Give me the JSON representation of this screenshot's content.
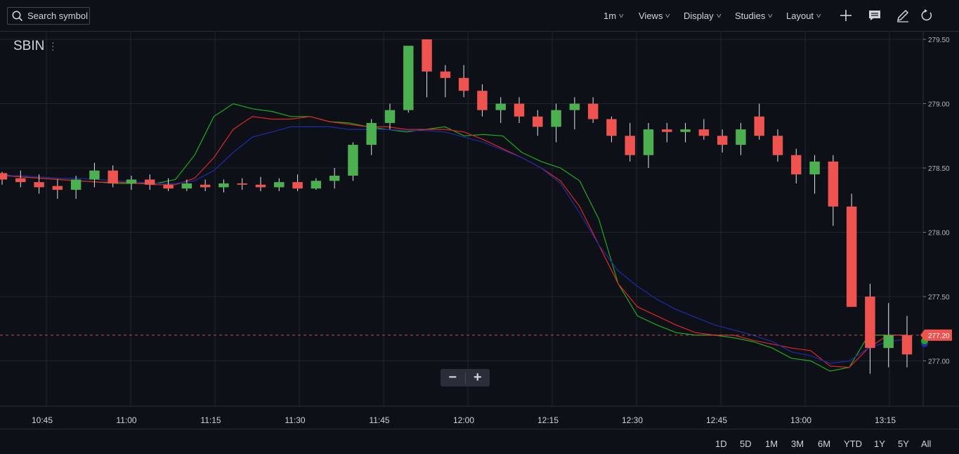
{
  "toolbar": {
    "search_placeholder": "Search symbol",
    "interval": "1m",
    "views": "Views",
    "display": "Display",
    "studies": "Studies",
    "layout": "Layout",
    "icons": [
      "plus-icon",
      "comment-icon",
      "pencil-icon",
      "refresh-icon"
    ]
  },
  "symbol": "SBIN",
  "zoom": {
    "minus": "−",
    "plus": "+"
  },
  "ranges": [
    "1D",
    "5D",
    "1M",
    "3M",
    "6M",
    "YTD",
    "1Y",
    "5Y",
    "All"
  ],
  "colors": {
    "up": "#4caf50",
    "down": "#ef5350",
    "ma_fast": "#1faa1f",
    "ma_mid": "#e02424",
    "ma_slow": "#1f2aa8",
    "background": "#0d1117",
    "grid": "#1f232d"
  },
  "chart_data": {
    "type": "candlestick",
    "symbol": "SBIN",
    "interval": "1m",
    "x_ticks": [
      "10:45",
      "11:00",
      "11:15",
      "11:30",
      "11:45",
      "12:00",
      "12:15",
      "12:30",
      "12:45",
      "13:00",
      "13:15"
    ],
    "y_ticks": [
      "279.50",
      "279.00",
      "278.50",
      "278.00",
      "277.50",
      "277.00"
    ],
    "ylim": [
      276.63,
      279.57
    ],
    "last_price": "277.20",
    "grid": true,
    "series_ma": [
      {
        "color": "green",
        "values": [
          278.45,
          278.43,
          278.42,
          278.41,
          278.4,
          278.39,
          278.38,
          278.38,
          278.38,
          278.41,
          278.6,
          278.9,
          279.0,
          278.96,
          278.94,
          278.9,
          278.9,
          278.86,
          278.85,
          278.82,
          278.8,
          278.78,
          278.8,
          278.82,
          278.75,
          278.76,
          278.75,
          278.62,
          278.55,
          278.5,
          278.4,
          278.1,
          277.6,
          277.35,
          277.28,
          277.22,
          277.2,
          277.2,
          277.18,
          277.15,
          277.1,
          277.02,
          277.0,
          276.92,
          276.95,
          277.2,
          277.2,
          277.2
        ]
      },
      {
        "color": "red",
        "values": [
          278.44,
          278.43,
          278.42,
          278.41,
          278.4,
          278.39,
          278.39,
          278.38,
          278.37,
          278.37,
          278.42,
          278.58,
          278.8,
          278.9,
          278.88,
          278.88,
          278.9,
          278.86,
          278.84,
          278.82,
          278.82,
          278.8,
          278.8,
          278.8,
          278.78,
          278.72,
          278.65,
          278.58,
          278.5,
          278.4,
          278.2,
          277.9,
          277.6,
          277.42,
          277.35,
          277.28,
          277.22,
          277.2,
          277.2,
          277.16,
          277.13,
          277.1,
          277.08,
          276.96,
          276.95,
          277.1,
          277.2,
          277.2
        ]
      },
      {
        "color": "blue",
        "values": [
          278.44,
          278.44,
          278.43,
          278.42,
          278.42,
          278.41,
          278.4,
          278.39,
          278.38,
          278.38,
          278.4,
          278.48,
          278.62,
          278.74,
          278.78,
          278.82,
          278.82,
          278.82,
          278.8,
          278.8,
          278.8,
          278.79,
          278.79,
          278.78,
          278.74,
          278.7,
          278.64,
          278.58,
          278.5,
          278.38,
          278.15,
          277.9,
          277.7,
          277.58,
          277.48,
          277.4,
          277.34,
          277.28,
          277.24,
          277.2,
          277.15,
          277.07,
          277.04,
          276.98,
          277.0,
          277.1,
          277.15,
          277.17
        ]
      }
    ],
    "candles": [
      [
        278.46,
        278.47,
        278.37,
        278.41
      ],
      [
        278.42,
        278.48,
        278.35,
        278.39
      ],
      [
        278.39,
        278.45,
        278.3,
        278.35
      ],
      [
        278.36,
        278.41,
        278.26,
        278.33
      ],
      [
        278.33,
        278.44,
        278.26,
        278.41
      ],
      [
        278.41,
        278.54,
        278.35,
        278.48
      ],
      [
        278.48,
        278.52,
        278.35,
        278.38
      ],
      [
        278.38,
        278.44,
        278.33,
        278.41
      ],
      [
        278.41,
        278.45,
        278.33,
        278.37
      ],
      [
        278.37,
        278.42,
        278.32,
        278.34
      ],
      [
        278.34,
        278.41,
        278.32,
        278.38
      ],
      [
        278.37,
        278.41,
        278.32,
        278.35
      ],
      [
        278.35,
        278.41,
        278.31,
        278.38
      ],
      [
        278.38,
        278.42,
        278.33,
        278.37
      ],
      [
        278.37,
        278.43,
        278.32,
        278.35
      ],
      [
        278.35,
        278.42,
        278.32,
        278.39
      ],
      [
        278.39,
        278.45,
        278.32,
        278.34
      ],
      [
        278.34,
        278.42,
        278.33,
        278.4
      ],
      [
        278.4,
        278.5,
        278.34,
        278.44
      ],
      [
        278.44,
        278.7,
        278.4,
        278.68
      ],
      [
        278.68,
        278.88,
        278.6,
        278.85
      ],
      [
        278.85,
        279.0,
        278.8,
        278.95
      ],
      [
        278.95,
        279.45,
        278.93,
        279.45
      ],
      [
        279.5,
        279.5,
        279.05,
        279.25
      ],
      [
        279.25,
        279.3,
        279.05,
        279.2
      ],
      [
        279.2,
        279.3,
        279.05,
        279.1
      ],
      [
        279.1,
        279.15,
        278.9,
        278.95
      ],
      [
        278.95,
        279.05,
        278.85,
        279.0
      ],
      [
        279.0,
        279.05,
        278.85,
        278.9
      ],
      [
        278.9,
        278.95,
        278.75,
        278.82
      ],
      [
        278.82,
        279.0,
        278.7,
        278.95
      ],
      [
        278.95,
        279.05,
        278.8,
        279.0
      ],
      [
        279.0,
        279.05,
        278.85,
        278.88
      ],
      [
        278.88,
        278.9,
        278.7,
        278.75
      ],
      [
        278.75,
        278.85,
        278.55,
        278.6
      ],
      [
        278.6,
        278.85,
        278.5,
        278.8
      ],
      [
        278.8,
        278.85,
        278.7,
        278.78
      ],
      [
        278.78,
        278.85,
        278.7,
        278.8
      ],
      [
        278.8,
        278.88,
        278.72,
        278.75
      ],
      [
        278.75,
        278.8,
        278.62,
        278.68
      ],
      [
        278.68,
        278.85,
        278.6,
        278.8
      ],
      [
        278.9,
        279.0,
        278.72,
        278.75
      ],
      [
        278.75,
        278.8,
        278.55,
        278.6
      ],
      [
        278.6,
        278.65,
        278.38,
        278.45
      ],
      [
        278.45,
        278.6,
        278.3,
        278.55
      ],
      [
        278.55,
        278.6,
        278.05,
        278.2
      ],
      [
        278.2,
        278.3,
        277.42,
        277.42
      ],
      [
        277.5,
        277.6,
        276.9,
        277.1
      ],
      [
        277.1,
        277.45,
        276.95,
        277.2
      ],
      [
        277.2,
        277.35,
        276.95,
        277.05
      ]
    ]
  }
}
